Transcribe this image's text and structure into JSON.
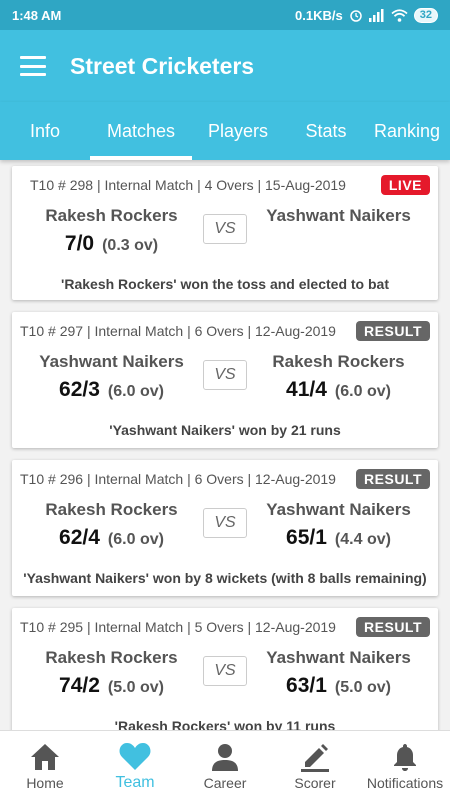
{
  "status_bar": {
    "time": "1:48 AM",
    "network_speed": "0.1KB/s",
    "battery": "32"
  },
  "app": {
    "title": "Street Cricketers",
    "accent_color": "#41c0e0"
  },
  "tabs": [
    {
      "label": "Info",
      "active": false
    },
    {
      "label": "Matches",
      "active": true
    },
    {
      "label": "Players",
      "active": false
    },
    {
      "label": "Stats",
      "active": false
    },
    {
      "label": "Ranking",
      "active": false
    }
  ],
  "matches": [
    {
      "meta": "T10 # 298 | Internal Match | 4 Overs | 15-Aug-2019",
      "status": "LIVE",
      "team1": {
        "name": "Rakesh Rockers",
        "score": "7/0",
        "overs": "(0.3 ov)"
      },
      "vs": "VS",
      "team2": {
        "name": "Yashwant Naikers",
        "score": "",
        "overs": ""
      },
      "summary": "'Rakesh Rockers' won the toss and elected to bat"
    },
    {
      "meta": "T10 # 297 | Internal Match | 6 Overs | 12-Aug-2019",
      "status": "RESULT",
      "team1": {
        "name": "Yashwant Naikers",
        "score": "62/3",
        "overs": "(6.0 ov)"
      },
      "vs": "VS",
      "team2": {
        "name": "Rakesh Rockers",
        "score": "41/4",
        "overs": "(6.0 ov)"
      },
      "summary": "'Yashwant Naikers'  won by 21 runs"
    },
    {
      "meta": "T10 # 296 | Internal Match | 6 Overs | 12-Aug-2019",
      "status": "RESULT",
      "team1": {
        "name": "Rakesh Rockers",
        "score": "62/4",
        "overs": "(6.0 ov)"
      },
      "vs": "VS",
      "team2": {
        "name": "Yashwant Naikers",
        "score": "65/1",
        "overs": "(4.4 ov)"
      },
      "summary": "'Yashwant Naikers'  won by 8 wickets (with 8 balls remaining)"
    },
    {
      "meta": "T10 # 295 | Internal Match | 5 Overs | 12-Aug-2019",
      "status": "RESULT",
      "team1": {
        "name": "Rakesh Rockers",
        "score": "74/2",
        "overs": "(5.0 ov)"
      },
      "vs": "VS",
      "team2": {
        "name": "Yashwant Naikers",
        "score": "63/1",
        "overs": "(5.0 ov)"
      },
      "summary": "'Rakesh Rockers'  won by 11 runs"
    }
  ],
  "bottom_nav": [
    {
      "label": "Home",
      "icon": "home-icon",
      "active": false
    },
    {
      "label": "Team",
      "icon": "heart-icon",
      "active": true
    },
    {
      "label": "Career",
      "icon": "person-icon",
      "active": false
    },
    {
      "label": "Scorer",
      "icon": "pen-icon",
      "active": false
    },
    {
      "label": "Notifications",
      "icon": "bell-icon",
      "active": false
    }
  ]
}
